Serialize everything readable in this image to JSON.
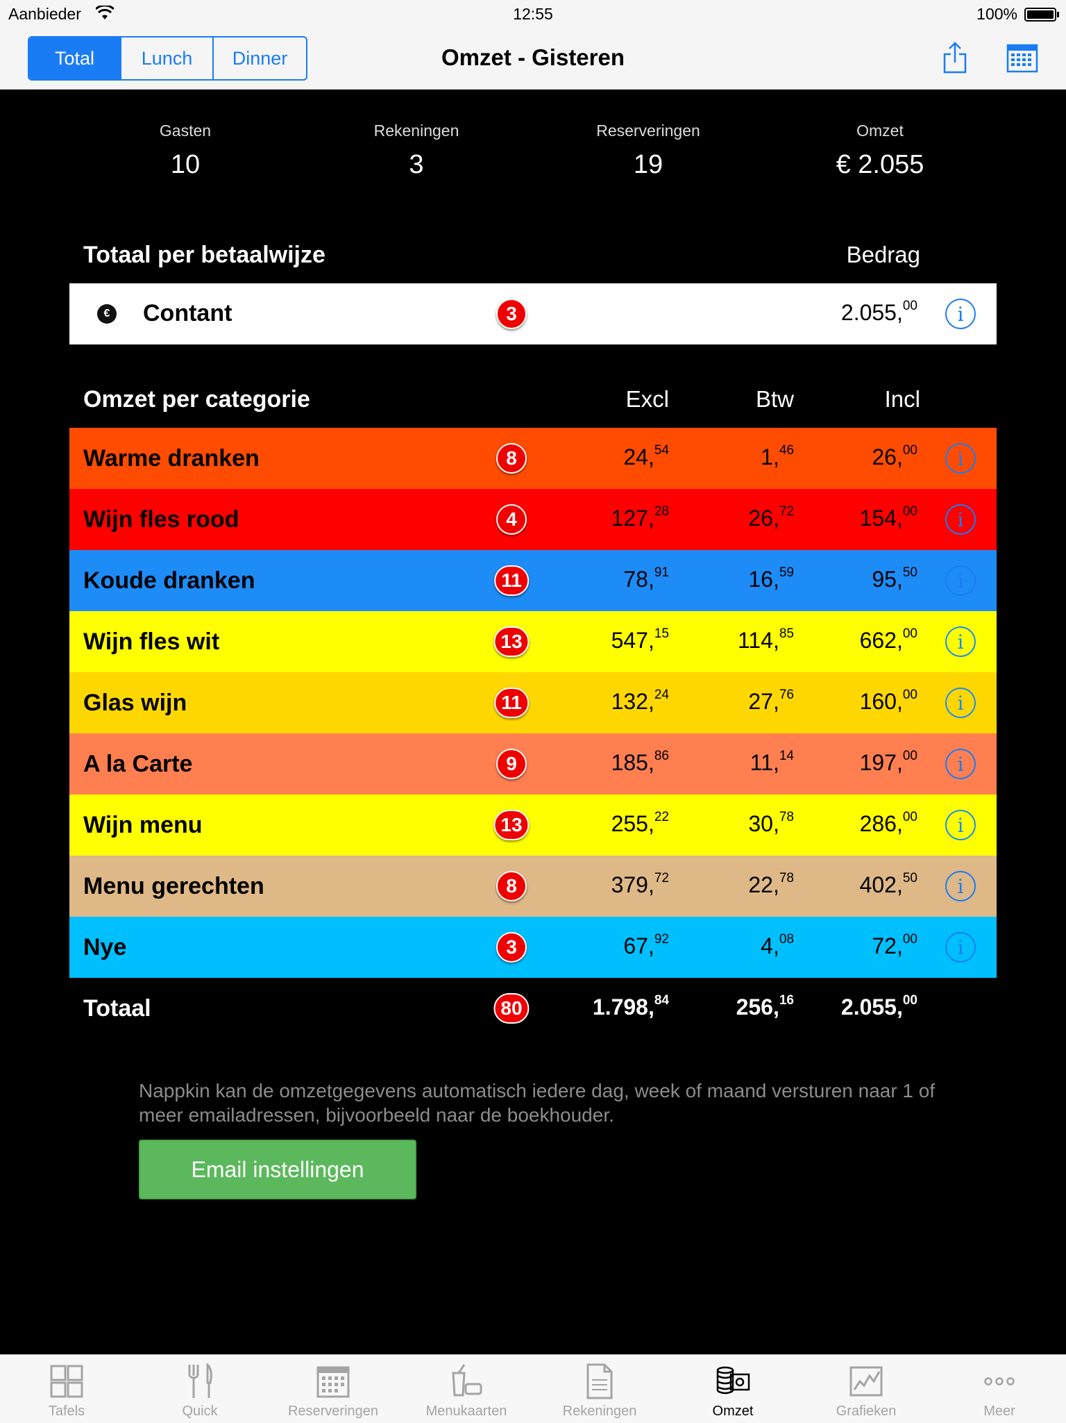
{
  "status_bar": {
    "carrier": "Aanbieder",
    "time": "12:55",
    "battery": "100%"
  },
  "nav": {
    "segments": [
      {
        "label": "Total",
        "active": true
      },
      {
        "label": "Lunch",
        "active": false
      },
      {
        "label": "Dinner",
        "active": false
      }
    ],
    "title": "Omzet - Gisteren",
    "share_icon": "share-icon",
    "calendar_icon": "calendar-icon"
  },
  "stats": [
    {
      "label": "Gasten",
      "value": "10"
    },
    {
      "label": "Rekeningen",
      "value": "3"
    },
    {
      "label": "Reserveringen",
      "value": "19"
    },
    {
      "label": "Omzet",
      "value": "€ 2.055"
    }
  ],
  "payment": {
    "title": "Totaal per betaalwijze",
    "amount_header": "Bedrag",
    "rows": [
      {
        "icon": "euro-coin-icon",
        "label": "Contant",
        "count": "3",
        "amount_int": "2.055,",
        "amount_dec": "00"
      }
    ]
  },
  "categories": {
    "title": "Omzet per categorie",
    "headers": {
      "excl": "Excl",
      "btw": "Btw",
      "incl": "Incl"
    },
    "rows": [
      {
        "name": "Warme dranken",
        "count": "8",
        "color": "#ff4c00",
        "info_color": "#1a7cf5",
        "excl_int": "24,",
        "excl_dec": "54",
        "btw_int": "1,",
        "btw_dec": "46",
        "incl_int": "26,",
        "incl_dec": "00"
      },
      {
        "name": "Wijn fles rood",
        "count": "4",
        "color": "#ff0000",
        "info_color": "#1a7cf5",
        "excl_int": "127,",
        "excl_dec": "28",
        "btw_int": "26,",
        "btw_dec": "72",
        "incl_int": "154,",
        "incl_dec": "00"
      },
      {
        "name": "Koude dranken",
        "count": "11",
        "color": "#1e8cf7",
        "info_color": "#1a7cf5",
        "excl_int": "78,",
        "excl_dec": "91",
        "btw_int": "16,",
        "btw_dec": "59",
        "incl_int": "95,",
        "incl_dec": "50"
      },
      {
        "name": "Wijn fles wit",
        "count": "13",
        "color": "#ffff00",
        "info_color": "#1a8cf5",
        "excl_int": "547,",
        "excl_dec": "15",
        "btw_int": "114,",
        "btw_dec": "85",
        "incl_int": "662,",
        "incl_dec": "00"
      },
      {
        "name": "Glas wijn",
        "count": "11",
        "color": "#ffd700",
        "info_color": "#1a8cf5",
        "excl_int": "132,",
        "excl_dec": "24",
        "btw_int": "27,",
        "btw_dec": "76",
        "incl_int": "160,",
        "incl_dec": "00"
      },
      {
        "name": "A la Carte",
        "count": "9",
        "color": "#ff7f50",
        "info_color": "#1a7cf5",
        "excl_int": "185,",
        "excl_dec": "86",
        "btw_int": "11,",
        "btw_dec": "14",
        "incl_int": "197,",
        "incl_dec": "00"
      },
      {
        "name": "Wijn menu",
        "count": "13",
        "color": "#ffff00",
        "info_color": "#1a8cf5",
        "excl_int": "255,",
        "excl_dec": "22",
        "btw_int": "30,",
        "btw_dec": "78",
        "incl_int": "286,",
        "incl_dec": "00"
      },
      {
        "name": "Menu gerechten",
        "count": "8",
        "color": "#deb887",
        "info_color": "#1a7cf5",
        "excl_int": "379,",
        "excl_dec": "72",
        "btw_int": "22,",
        "btw_dec": "78",
        "incl_int": "402,",
        "incl_dec": "50"
      },
      {
        "name": "Nye",
        "count": "3",
        "color": "#00bfff",
        "info_color": "#1a7cf5",
        "excl_int": "67,",
        "excl_dec": "92",
        "btw_int": "4,",
        "btw_dec": "08",
        "incl_int": "72,",
        "incl_dec": "00"
      }
    ],
    "total": {
      "label": "Totaal",
      "count": "80",
      "excl_int": "1.798,",
      "excl_dec": "84",
      "btw_int": "256,",
      "btw_dec": "16",
      "incl_int": "2.055,",
      "incl_dec": "00"
    }
  },
  "footer": {
    "text": "Nappkin kan de omzetgegevens automatisch iedere dag, week of maand versturen naar 1 of meer emailadressen, bijvoorbeeld naar de boekhouder.",
    "button_label": "Email instellingen"
  },
  "tabs": [
    {
      "label": "Tafels",
      "icon": "tables-grid-icon",
      "active": false
    },
    {
      "label": "Quick",
      "icon": "fork-knife-icon",
      "active": false
    },
    {
      "label": "Reserveringen",
      "icon": "calendar-icon",
      "active": false
    },
    {
      "label": "Menukaarten",
      "icon": "menu-drink-icon",
      "active": false
    },
    {
      "label": "Rekeningen",
      "icon": "document-icon",
      "active": false
    },
    {
      "label": "Omzet",
      "icon": "revenue-coins-icon",
      "active": true
    },
    {
      "label": "Grafieken",
      "icon": "line-graph-icon",
      "active": false
    },
    {
      "label": "Meer",
      "icon": "more-dots-icon",
      "active": false
    }
  ]
}
